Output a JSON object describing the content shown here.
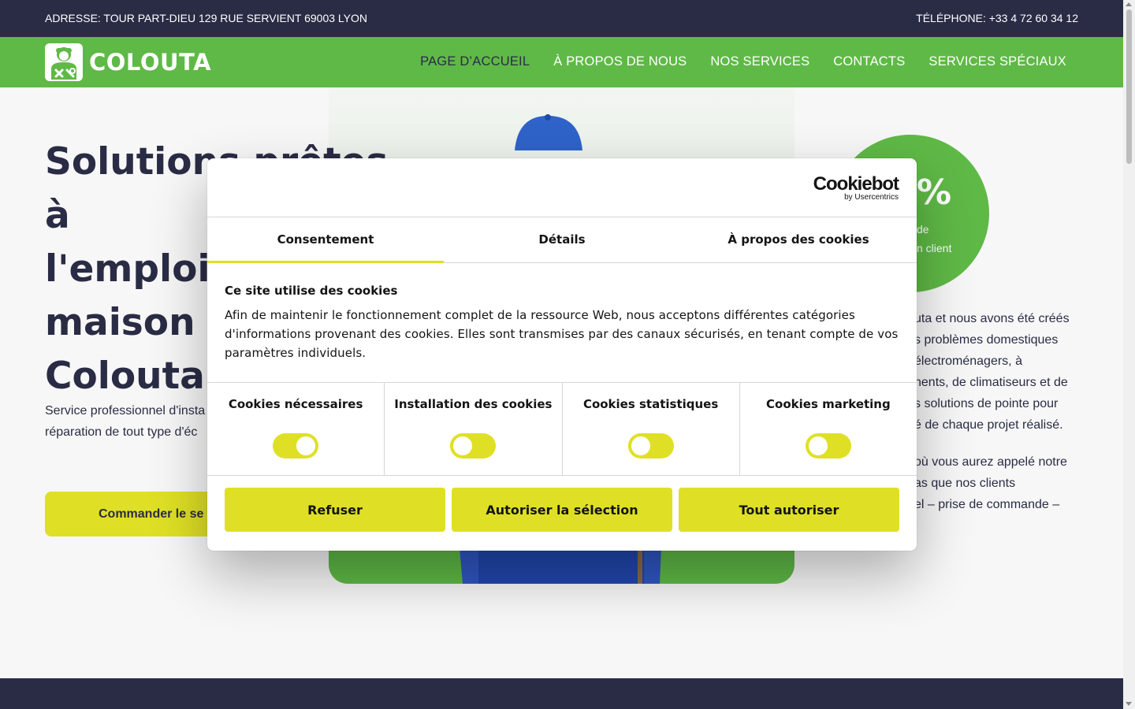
{
  "topbar": {
    "address": "ADRESSE: TOUR PART-DIEU 129 RUE SERVIENT 69003 LYON",
    "phone": "TÉLÉPHONE: +33 4 72 60 34 12"
  },
  "brand": {
    "name": "COLOUTA",
    "logo_icon": "repairman-icon"
  },
  "nav": {
    "items": [
      {
        "label": "PAGE D’ACCUEIL",
        "active": true
      },
      {
        "label": "À PROPOS DE NOUS"
      },
      {
        "label": "NOS SERVICES"
      },
      {
        "label": "CONTACTS"
      },
      {
        "label": "SERVICES SPÉCIAUX"
      }
    ]
  },
  "hero": {
    "title_lines": [
      "Solutions prêtes à",
      "l'emploi p",
      "maison d",
      "Colouta"
    ],
    "description_lines": [
      "Service professionnel d'insta",
      "réparation de tout type d'éc"
    ],
    "cta_label": "Commander le se"
  },
  "stat": {
    "value": "%",
    "label_lines": [
      "de",
      "n client"
    ]
  },
  "about": {
    "paragraph1_lines": [
      "uta et nous avons été créés",
      "s problèmes domestiques",
      "électroménagers, à",
      "nents, de climatiseurs et de",
      "s solutions de pointe pour",
      "é de chaque projet réalisé."
    ],
    "paragraph2_lines": [
      "où vous aurez appelé notre",
      "as que nos clients",
      "el – prise de commande –"
    ]
  },
  "cookie_dialog": {
    "brand": "Cookiebot",
    "brand_sub": "by Usercentrics",
    "tabs": [
      {
        "label": "Consentement",
        "active": true
      },
      {
        "label": "Détails"
      },
      {
        "label": "À propos des cookies"
      }
    ],
    "heading": "Ce site utilise des cookies",
    "body": "Afin de maintenir le fonctionnement complet de la ressource Web, nous acceptons différentes catégories d'informations provenant des cookies. Elles sont transmises par des canaux sécurisés, en tenant compte de vos paramètres individuels.",
    "categories": [
      {
        "label": "Cookies nécessaires",
        "enabled": true
      },
      {
        "label": "Installation des cookies",
        "enabled": false
      },
      {
        "label": "Cookies statistiques",
        "enabled": false
      },
      {
        "label": "Cookies marketing",
        "enabled": false
      }
    ],
    "buttons": {
      "refuse": "Refuser",
      "allow_selection": "Autoriser la sélection",
      "allow_all": "Tout autoriser"
    }
  },
  "colors": {
    "dark": "#2a2c45",
    "green": "#5fb946",
    "yellow": "#dfe025"
  }
}
